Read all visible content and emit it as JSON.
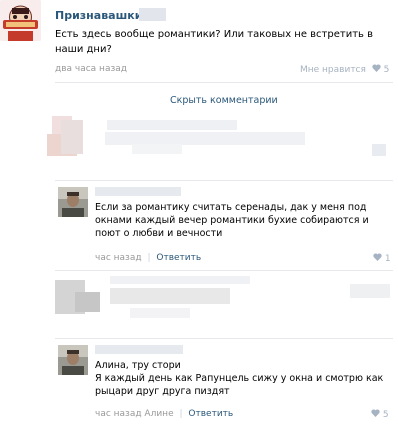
{
  "post": {
    "author": "Признавашки",
    "text_line1": "Есть здесь вообще романтики? Или таковых не встретить в",
    "text_line2": "наши дни?",
    "time": "два часа назад",
    "like_label": "Мне нравится",
    "like_count": "5"
  },
  "hide_comments": "Скрыть комментарии",
  "comments": [
    {
      "text_lines": [
        "Если за романтику считать серенады, дак у меня под",
        "окнами каждый вечер романтики бухие собираются и",
        "поют о любви и вечности"
      ],
      "time": "час назад",
      "reply": "Ответить",
      "likes": "1"
    },
    {
      "text_lines": [
        "Алина, тру стори",
        "Я каждый день как Рапунцель сижу у окна и смотрю как",
        "рыцари друг друга пиздят"
      ],
      "time": "час назад Алине",
      "reply": "Ответить",
      "likes": "5"
    }
  ],
  "colors": {
    "link": "#2b587a",
    "meta": "#999999",
    "like": "#a6b3c2",
    "avatar_bg": "#f3e8e8"
  }
}
